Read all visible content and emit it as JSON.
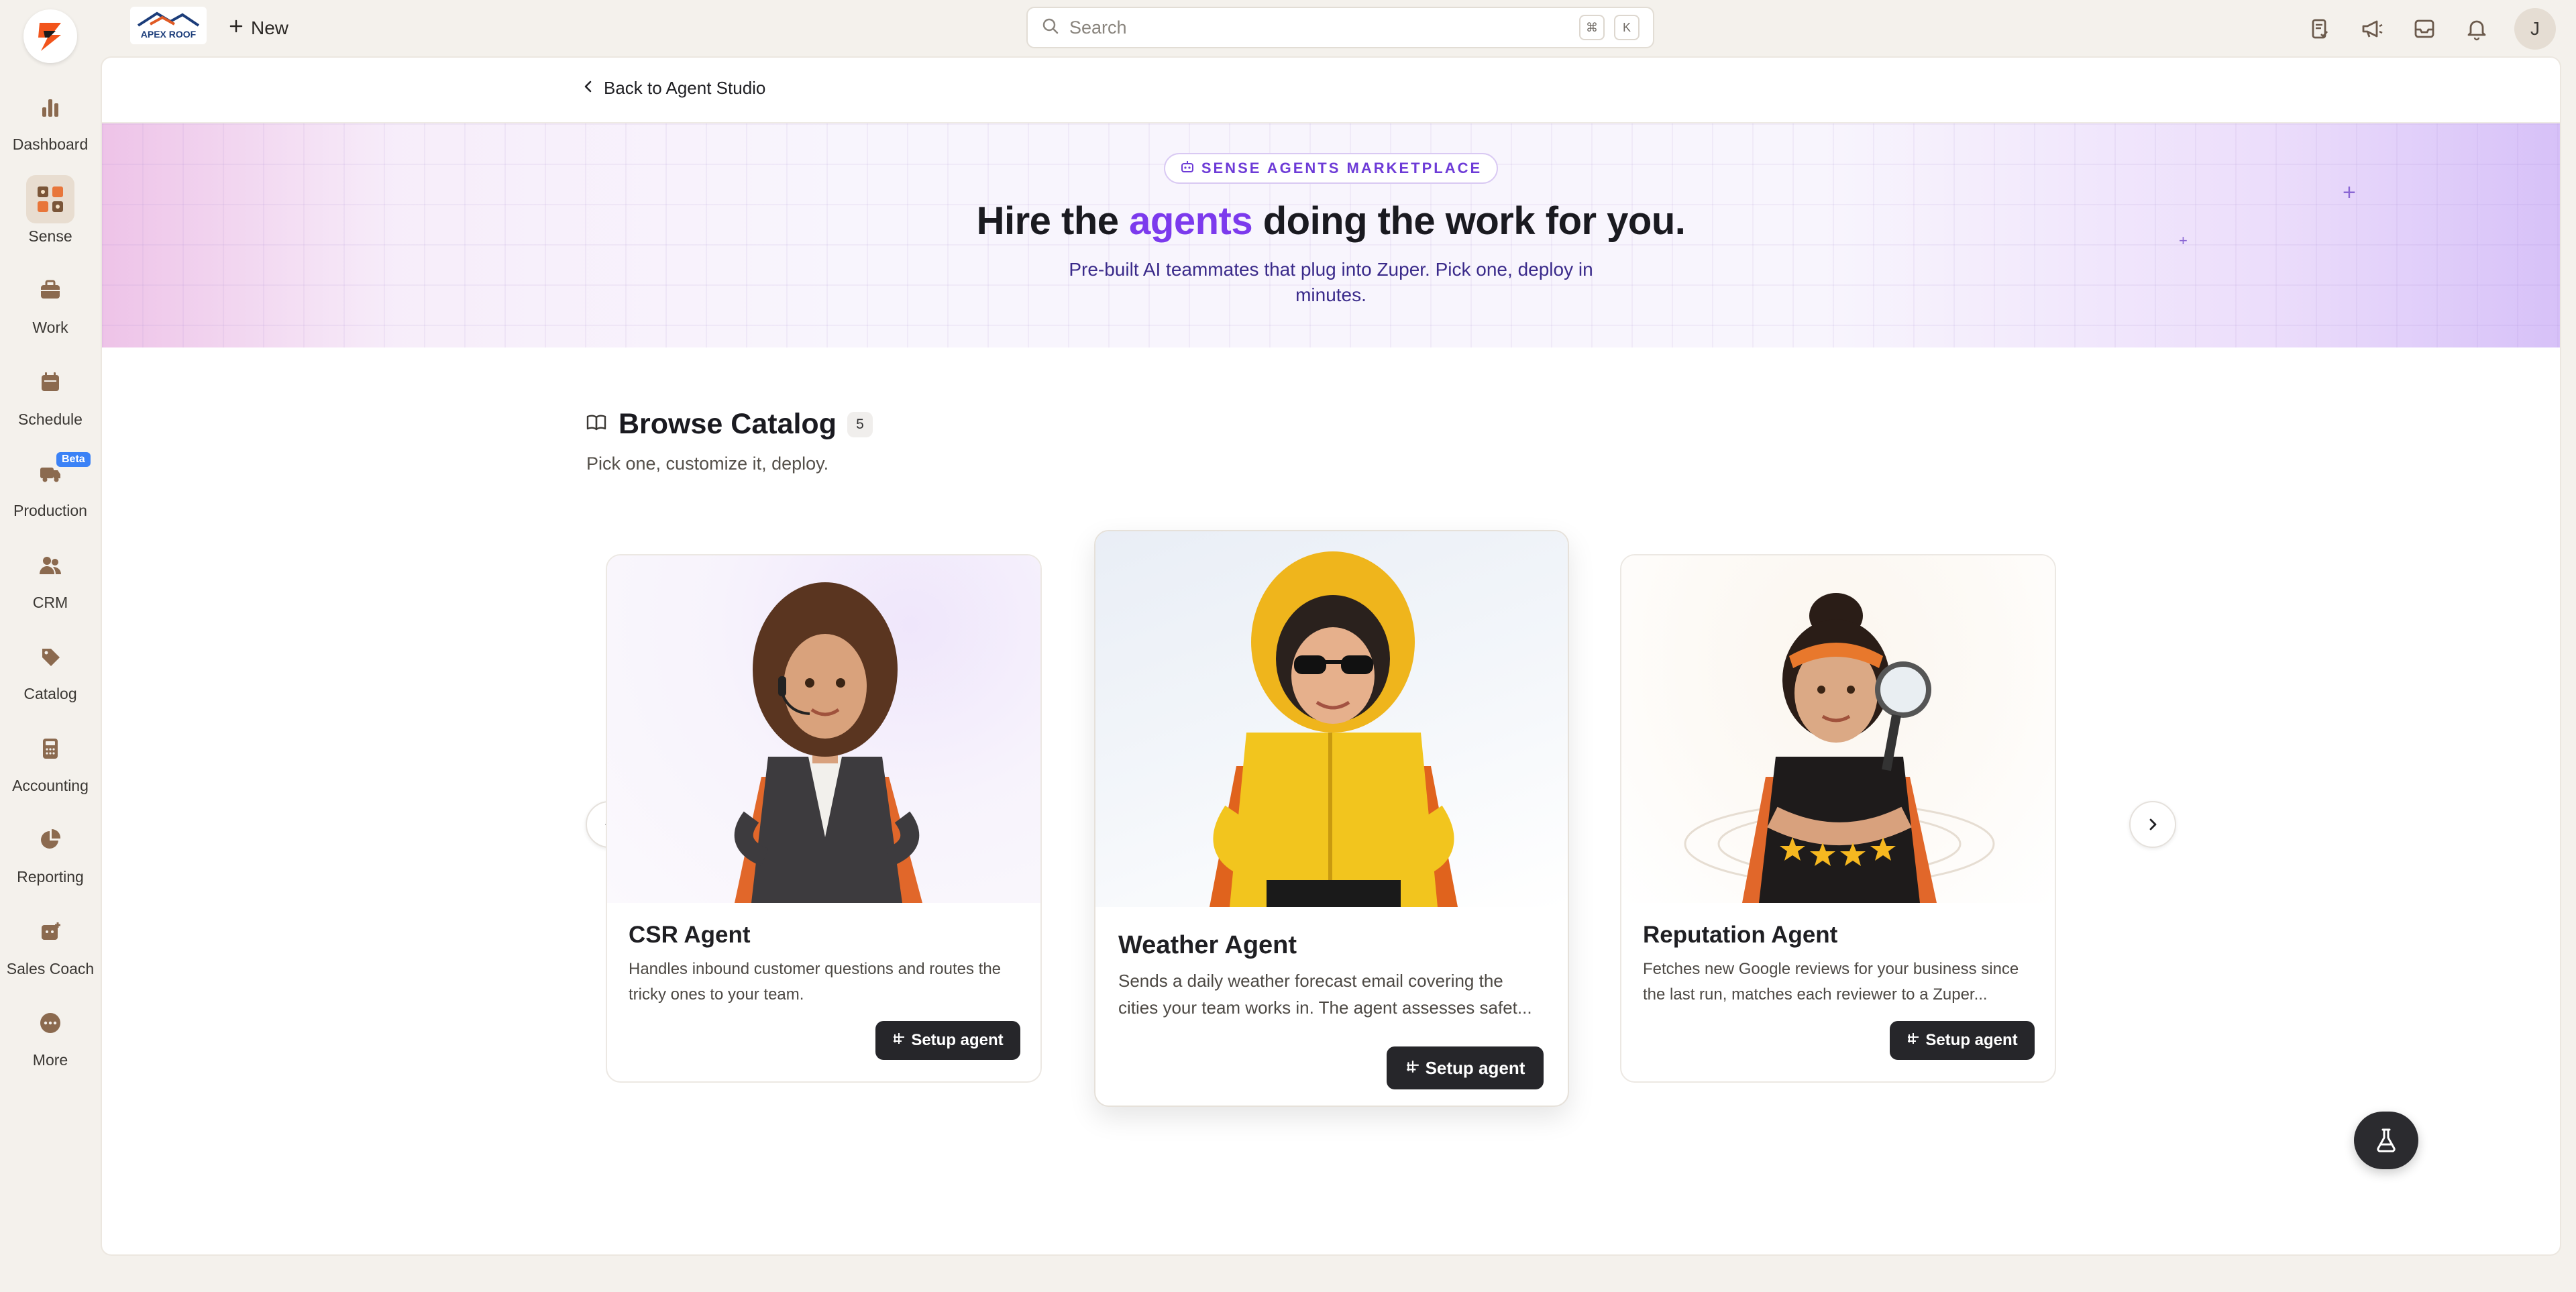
{
  "rail": {
    "items": [
      {
        "label": "Dashboard",
        "icon": "bar-chart-icon"
      },
      {
        "label": "Sense",
        "icon": "grid-icon",
        "active": true
      },
      {
        "label": "Work",
        "icon": "briefcase-icon"
      },
      {
        "label": "Schedule",
        "icon": "calendar-icon"
      },
      {
        "label": "Production",
        "icon": "truck-icon",
        "badge": "Beta"
      },
      {
        "label": "CRM",
        "icon": "users-icon"
      },
      {
        "label": "Catalog",
        "icon": "tag-icon"
      },
      {
        "label": "Accounting",
        "icon": "calculator-icon"
      },
      {
        "label": "Reporting",
        "icon": "pie-chart-icon"
      },
      {
        "label": "Sales Coach",
        "icon": "coach-icon"
      },
      {
        "label": "More",
        "icon": "more-icon"
      }
    ],
    "accent": "#8b6a4f"
  },
  "topbar": {
    "brand": "APEX ROOF",
    "new_label": "New",
    "search_placeholder": "Search",
    "kbd_1": "⌘",
    "kbd_2": "K",
    "avatar_initial": "J"
  },
  "back": {
    "label": "Back to Agent Studio"
  },
  "hero": {
    "pill": "SENSE AGENTS MARKETPLACE",
    "title_before": "Hire the ",
    "title_accent": "agents",
    "title_after": " doing the work for you.",
    "subtitle": "Pre-built AI teammates that plug into Zuper. Pick one, deploy in minutes.",
    "accent": "#7c3aed"
  },
  "catalog": {
    "title": "Browse Catalog",
    "count": "5",
    "subtitle": "Pick one, customize it, deploy."
  },
  "cards": [
    {
      "title": "CSR Agent",
      "desc": "Handles inbound customer questions and routes the tricky ones to your team.",
      "button": "Setup agent"
    },
    {
      "title": "Weather Agent",
      "desc": "Sends a daily weather forecast email covering the cities your team works in. The agent assesses safet...",
      "button": "Setup agent"
    },
    {
      "title": "Reputation Agent",
      "desc": "Fetches new Google reviews for your business since the last run, matches each reviewer to a Zuper...",
      "button": "Setup agent"
    }
  ]
}
